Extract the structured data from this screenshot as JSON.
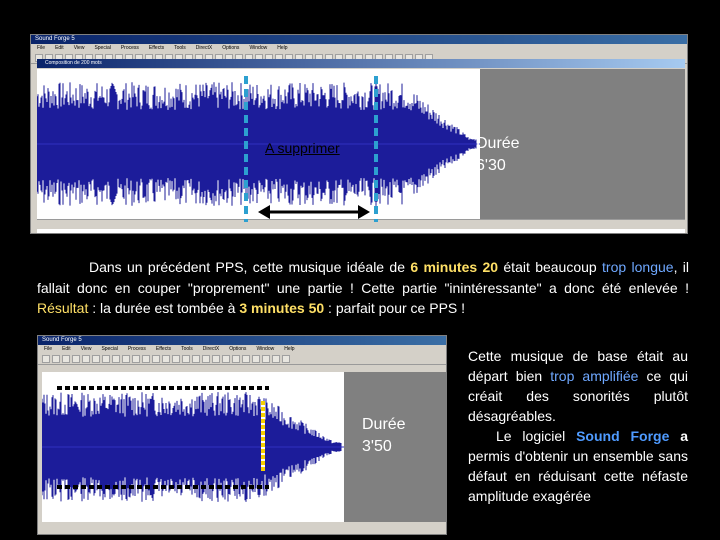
{
  "window1": {
    "title": "Sound Forge 5",
    "menu": [
      "File",
      "Edit",
      "View",
      "Special",
      "Process",
      "Effects",
      "Tools",
      "DirectX",
      "Options",
      "Window",
      "Help"
    ],
    "doc_title": "Composition de 200 mots"
  },
  "window2": {
    "title": "Sound Forge 5"
  },
  "labels": {
    "supprimer": "A supprimer",
    "duree1_line1": "Durée",
    "duree1_line2": "6'30",
    "duree2_line1": "Durée",
    "duree2_line2": "3'50"
  },
  "paragraph": {
    "p1": "Dans un précédent PPS, cette musique idéale de ",
    "p2": "6 minutes 20",
    "p3": " était beaucoup ",
    "p4": "trop longue",
    "p5": ", il fallait donc en couper \"proprement\" une partie ! Cette partie \"inintéressante\" a donc été enlevée ! ",
    "p6": "Résultat",
    "p7": " : la durée est tombée à ",
    "p8": "3 minutes 50",
    "p9": " : parfait pour ce PPS !"
  },
  "sidetext": {
    "s1": "Cette musique de base était au départ bien ",
    "s2": "trop amplifiée",
    "s3": " ce qui créait des sonorités plutôt désagréables.",
    "s4": "Le logiciel ",
    "s5": "Sound Forge",
    "s6": " a",
    "s7": " permis d'obtenir un ensemble sans défaut en réduisant cette néfaste amplitude exagérée"
  },
  "colors": {
    "waveform": "#1c1c9a",
    "highlight_yellow": "#ffe066",
    "highlight_blue": "#6fa8ff",
    "selection_gray": "#808080"
  }
}
